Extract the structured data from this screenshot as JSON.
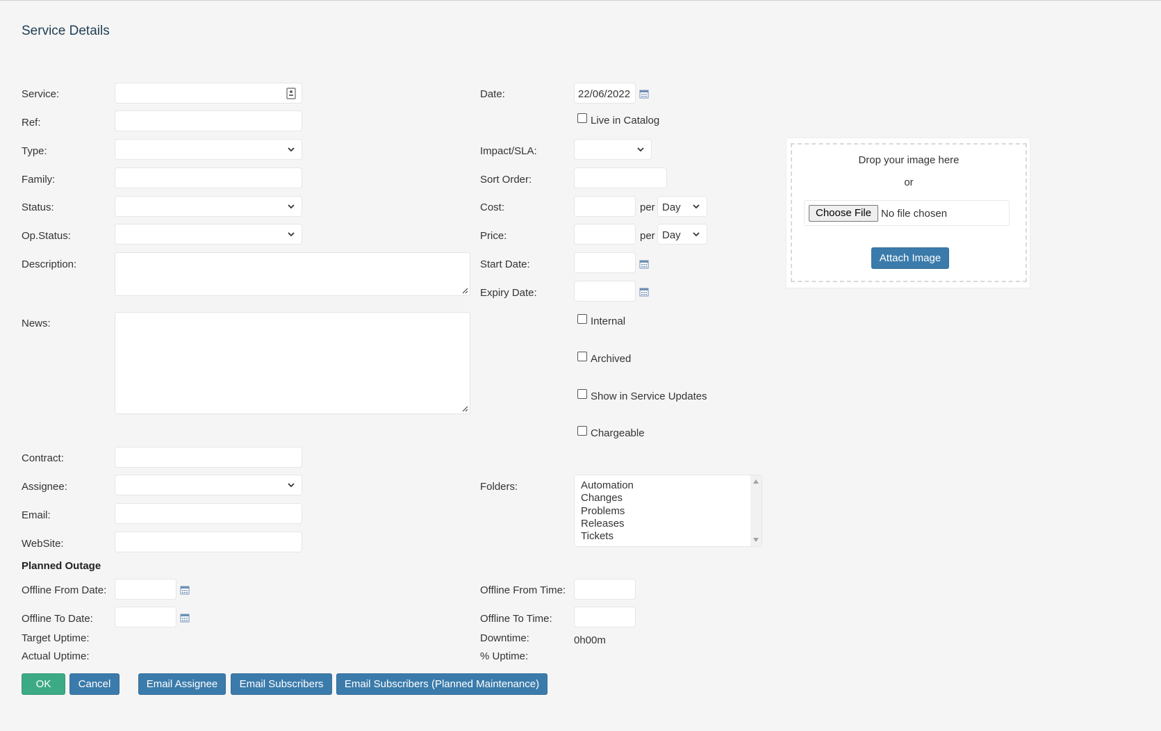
{
  "page_title": "Service Details",
  "left_labels": {
    "service": "Service:",
    "ref": "Ref:",
    "type": "Type:",
    "family": "Family:",
    "status": "Status:",
    "op_status": "Op.Status:",
    "description": "Description:",
    "news": "News:",
    "contract": "Contract:",
    "assignee": "Assignee:",
    "email": "Email:",
    "website": "WebSite:"
  },
  "right_labels": {
    "date": "Date:",
    "impact_sla": "Impact/SLA:",
    "sort_order": "Sort Order:",
    "cost": "Cost:",
    "price": "Price:",
    "start_date": "Start Date:",
    "expiry_date": "Expiry Date:",
    "folders": "Folders:"
  },
  "fields": {
    "date_value": "22/06/2022",
    "per_label": "per",
    "cost_unit": "Day",
    "price_unit": "Day"
  },
  "checkboxes": {
    "live_in_catalog": "Live in Catalog",
    "internal": "Internal",
    "archived": "Archived",
    "show_in_service_updates": "Show in Service Updates",
    "chargeable": "Chargeable"
  },
  "folders": [
    "Automation",
    "Changes",
    "Problems",
    "Releases",
    "Tickets"
  ],
  "planned_outage": {
    "heading": "Planned Outage",
    "offline_from_date": "Offline From Date:",
    "offline_to_date": "Offline To Date:",
    "target_uptime": "Target Uptime:",
    "actual_uptime": "Actual Uptime:",
    "offline_from_time": "Offline From Time:",
    "offline_to_time": "Offline To Time:",
    "downtime": "Downtime:",
    "downtime_value": "0h00m",
    "pct_uptime": "% Uptime:"
  },
  "image_upload": {
    "drop_text": "Drop your image here",
    "or_text": "or",
    "choose_file": "Choose File",
    "no_file": "No file chosen",
    "attach_button": "Attach Image"
  },
  "buttons": {
    "ok": "OK",
    "cancel": "Cancel",
    "email_assignee": "Email Assignee",
    "email_subscribers": "Email Subscribers",
    "email_subscribers_planned": "Email Subscribers (Planned Maintenance)"
  },
  "colors": {
    "primary_button": "#3b7bab",
    "ok_button": "#3daa86",
    "background": "#f5f5f5"
  }
}
